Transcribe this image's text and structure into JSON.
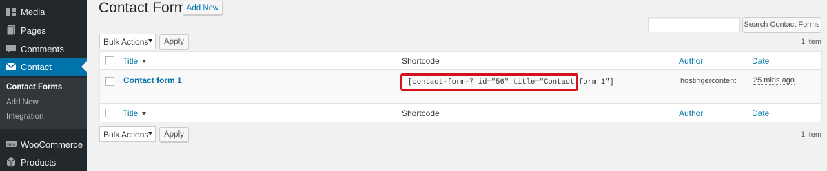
{
  "sidebar": {
    "items": [
      {
        "label": "Media",
        "icon": "media-icon"
      },
      {
        "label": "Pages",
        "icon": "pages-icon"
      },
      {
        "label": "Comments",
        "icon": "comments-icon"
      },
      {
        "label": "Contact",
        "icon": "mail-icon"
      },
      {
        "label": "WooCommerce",
        "icon": "woocommerce-icon"
      },
      {
        "label": "Products",
        "icon": "products-icon"
      }
    ],
    "submenu": [
      {
        "label": "Contact Forms"
      },
      {
        "label": "Add New"
      },
      {
        "label": "Integration"
      }
    ]
  },
  "header": {
    "title": "Contact Forms",
    "add_new_label": "Add New"
  },
  "search": {
    "value": "",
    "button_label": "Search Contact Forms"
  },
  "bulk": {
    "top_select": "Bulk Actions",
    "top_apply": "Apply",
    "bottom_select": "Bulk Actions",
    "bottom_apply": "Apply"
  },
  "item_count": {
    "top": "1 item",
    "bottom": "1 item"
  },
  "table": {
    "columns": {
      "title": "Title",
      "shortcode": "Shortcode",
      "author": "Author",
      "date": "Date"
    },
    "rows": [
      {
        "title": "Contact form 1",
        "shortcode": "[contact-form-7 id=\"56\" title=\"Contact form 1\"]",
        "author": "hostingercontent",
        "date": "25 mins ago"
      }
    ]
  },
  "colors": {
    "sidebar_bg": "#23282d",
    "active_menu": "#0073aa",
    "link": "#0073aa",
    "highlight_box": "#d5121c"
  }
}
